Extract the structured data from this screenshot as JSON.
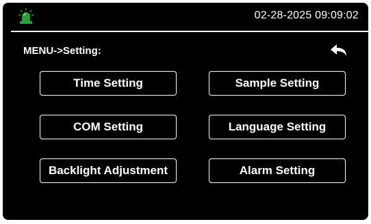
{
  "status_bar": {
    "datetime": "02-28-2025 09:09:02",
    "alarm_icon": "alarm-beacon-icon",
    "alarm_icon_color": "#2e9e3a"
  },
  "header": {
    "breadcrumb": "MENU->Setting:",
    "back_icon": "back-arrow-icon"
  },
  "menu": {
    "time_setting": "Time Setting",
    "sample_setting": "Sample Setting",
    "com_setting": "COM Setting",
    "language_setting": "Language Setting",
    "backlight_adjustment": "Backlight Adjustment",
    "alarm_setting": "Alarm Setting"
  },
  "colors": {
    "background": "#000000",
    "foreground": "#ffffff"
  }
}
